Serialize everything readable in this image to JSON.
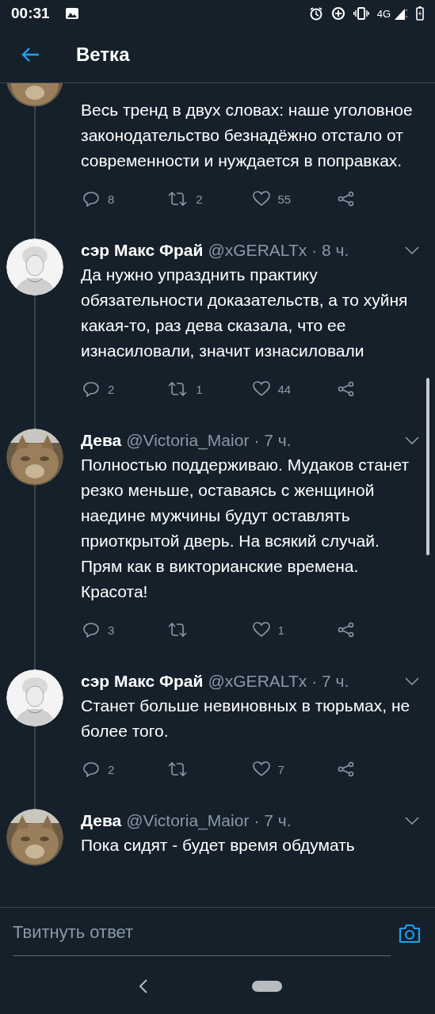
{
  "status_bar": {
    "time": "00:31",
    "network": "4G"
  },
  "header": {
    "title": "Ветка"
  },
  "tweets": [
    {
      "avatar": {
        "kind": "cat"
      },
      "text": "Весь тренд в двух словах: наше уголовное законодательство безнадёжно отстало от современности и нуждается в поправках.",
      "actions": {
        "replies": "8",
        "retweets": "2",
        "likes": "55"
      }
    },
    {
      "avatar": {
        "kind": "sketch"
      },
      "name": "сэр Макс Фрай",
      "handle": "@xGERALTx",
      "time": "· 8 ч.",
      "text": "Да нужно упразднить практику обязательности доказательств, а то хуйня какая-то, раз дева сказала, что ее изнасиловали, значит изнасиловали",
      "actions": {
        "replies": "2",
        "retweets": "1",
        "likes": "44"
      }
    },
    {
      "avatar": {
        "kind": "cat"
      },
      "name": "Дева",
      "handle": "@Victoria_Maior",
      "time": "· 7 ч.",
      "text": "Полностью поддерживаю. Мудаков станет резко меньше, оставаясь с женщиной наедине мужчины будут оставлять приоткрытой дверь. На всякий случай. Прям как в викторианские времена. Красота!",
      "actions": {
        "replies": "3",
        "likes": "1"
      }
    },
    {
      "avatar": {
        "kind": "sketch"
      },
      "name": "сэр Макс Фрай",
      "handle": "@xGERALTx",
      "time": "· 7 ч.",
      "text": "Станет больше невиновных в тюрьмах, не более того.",
      "actions": {
        "replies": "2",
        "likes": "7"
      }
    },
    {
      "avatar": {
        "kind": "cat"
      },
      "name": "Дева",
      "handle": "@Victoria_Maior",
      "time": "· 7 ч.",
      "text": "Пока сидят - будет время обдумать"
    }
  ],
  "reply_bar": {
    "placeholder": "Твитнуть ответ"
  }
}
